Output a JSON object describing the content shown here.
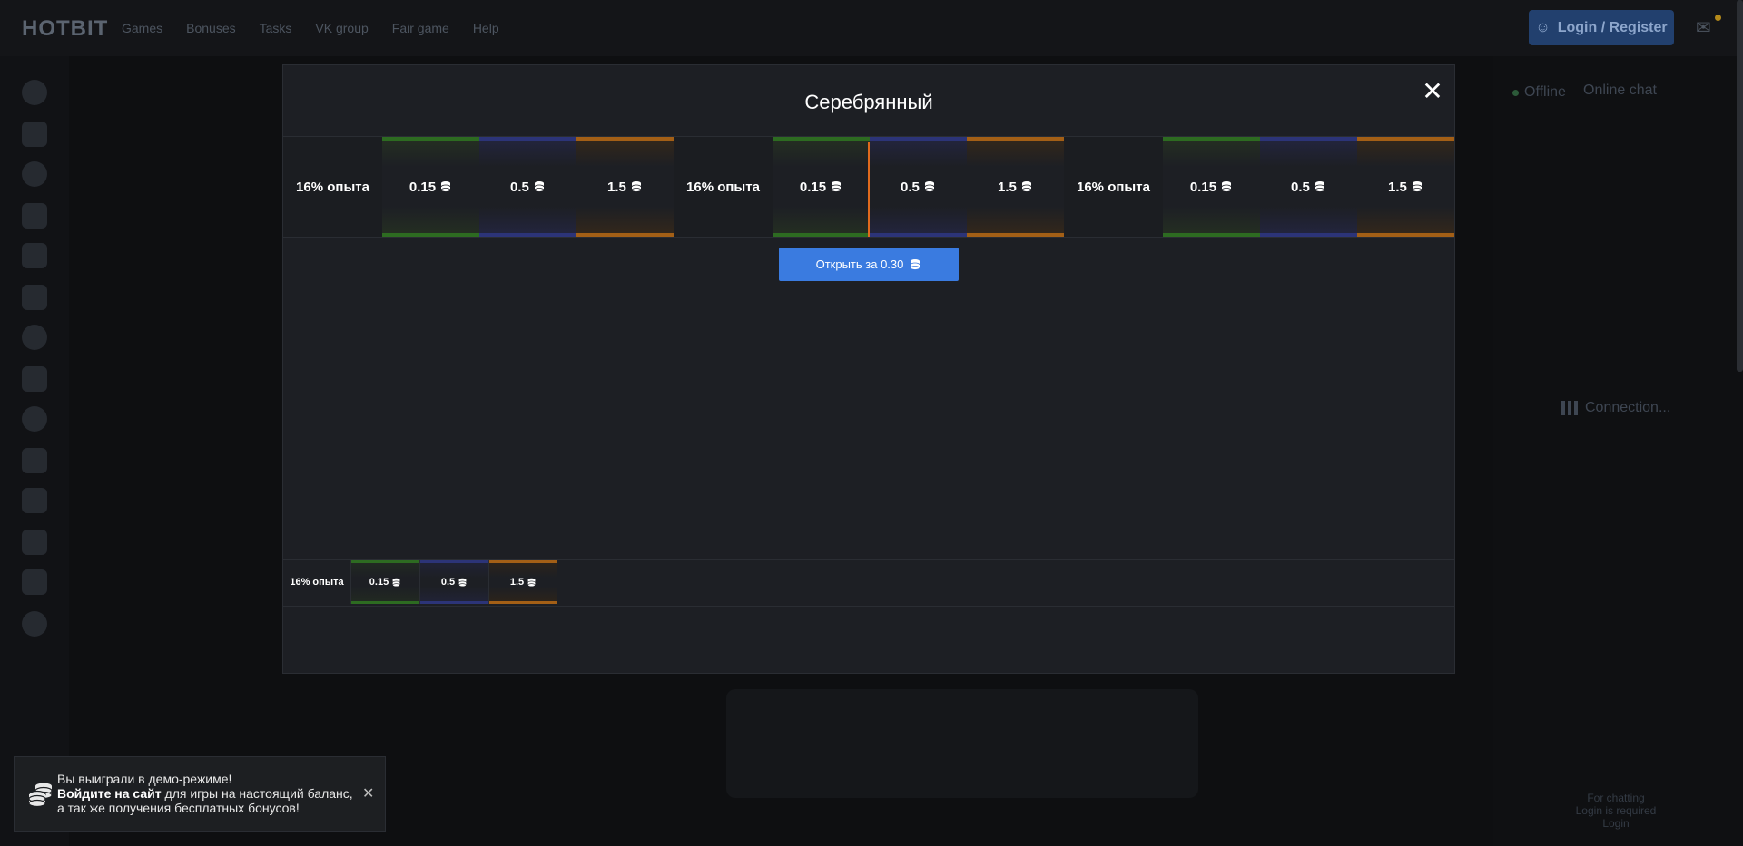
{
  "header": {
    "logo": "HOTBIT",
    "nav": [
      "Games",
      "Bonuses",
      "Tasks",
      "VK group",
      "Fair game",
      "Help"
    ],
    "login_label": "Login / Register"
  },
  "chat": {
    "status": "Offline",
    "title": "Online chat",
    "connection": "Connection...",
    "footer_line1": "For chatting",
    "footer_line2": "Login is required",
    "footer_link": "Login"
  },
  "modal": {
    "title": "Серебрянный",
    "close_symbol": "✕",
    "strip_items": [
      {
        "label": "16% опыта",
        "kind": "xp"
      },
      {
        "label": "0.15",
        "kind": "green"
      },
      {
        "label": "0.5",
        "kind": "blue"
      },
      {
        "label": "1.5",
        "kind": "orange"
      },
      {
        "label": "16% опыта",
        "kind": "xp"
      },
      {
        "label": "0.15",
        "kind": "green"
      },
      {
        "label": "0.5",
        "kind": "blue"
      },
      {
        "label": "1.5",
        "kind": "orange"
      },
      {
        "label": "16% опыта",
        "kind": "xp"
      },
      {
        "label": "0.15",
        "kind": "green"
      },
      {
        "label": "0.5",
        "kind": "blue"
      },
      {
        "label": "1.5",
        "kind": "orange"
      }
    ],
    "open_button_label": "Открыть за 0.30",
    "contents": [
      {
        "label": "16% опыта",
        "kind": "xp"
      },
      {
        "label": "0.15",
        "kind": "green"
      },
      {
        "label": "0.5",
        "kind": "blue"
      },
      {
        "label": "1.5",
        "kind": "orange"
      }
    ]
  },
  "toast": {
    "line1": "Вы выиграли в демо-режиме!",
    "bold": "Войдите на сайт",
    "line2_rest": " для игры на настоящий баланс,",
    "line3": "а так же получения бесплатных бонусов!",
    "close_symbol": "✕"
  },
  "colors": {
    "accent": "#3a7be0",
    "tier_green": "#2d6b21",
    "tier_blue": "#2c3478",
    "tier_orange": "#a35f16",
    "marker": "#e06a1d"
  }
}
